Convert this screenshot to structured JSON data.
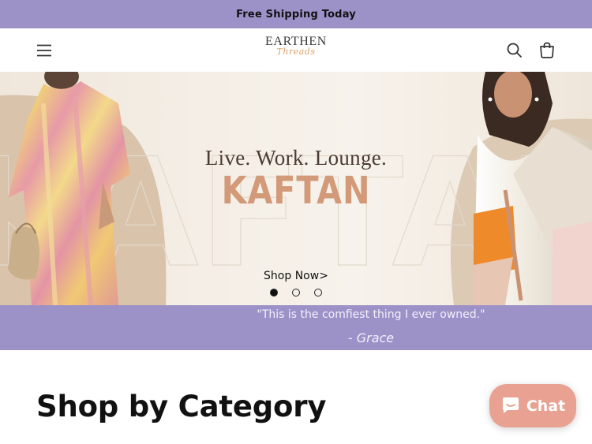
{
  "announcement": {
    "text": "Free Shipping Today"
  },
  "header": {
    "logo_main": "EARTHEN",
    "logo_sub": "Threads",
    "icons": {
      "menu": "hamburger-icon",
      "search": "search-icon",
      "cart": "cart-icon"
    }
  },
  "hero": {
    "tagline": "Live. Work. Lounge.",
    "title": "KAFTAN",
    "watermark": "KAFTAN",
    "cta": "Shop Now>",
    "slides": {
      "count": 3,
      "active": 1
    }
  },
  "testimonial": {
    "quote": "\"This is the comfiest thing I ever owned.\"",
    "author": "- Grace"
  },
  "section": {
    "title": "Shop by Category"
  },
  "chat": {
    "label": "Chat",
    "icon": "chat-bubble-icon"
  },
  "colors": {
    "accent_purple": "#9c92c8",
    "kaftan_tan": "#d29a78",
    "chat_button": "#e9a292",
    "hero_bg": "#f4eee6"
  }
}
